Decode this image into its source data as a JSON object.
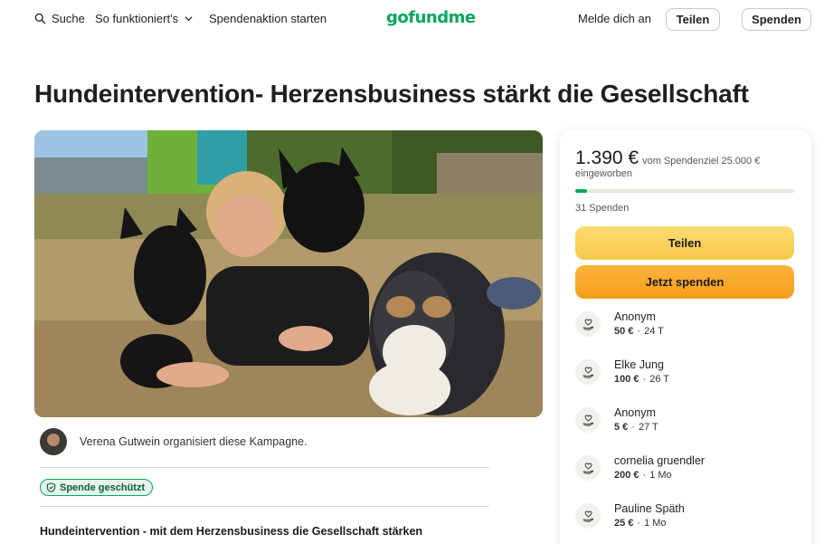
{
  "header": {
    "search_label": "Suche",
    "how_label": "So funktioniert's",
    "start_label": "Spendenaktion starten",
    "logo": "gofundme",
    "login_label": "Melde dich an",
    "share_label": "Teilen",
    "donate_label": "Spenden"
  },
  "campaign": {
    "title": "Hundeintervention- Herzensbusiness stärkt die Gesellschaft",
    "organizer_text": "Verena Gutwein organisiert diese Kampagne.",
    "badge_label": "Spende geschützt",
    "story_title": "Hundeintervention - mit dem Herzensbusiness die Gesellschaft stärken"
  },
  "donation_card": {
    "raised": "1.390 €",
    "goal_text": "vom Spendenziel 25.000 €",
    "raised_sub": "eingeworben",
    "progress_fraction": 0.0556,
    "count_text": "31 Spenden",
    "share_label": "Teilen",
    "donate_label": "Jetzt spenden",
    "donations": [
      {
        "name": "Anonym",
        "amount": "50 €",
        "time": "24 T"
      },
      {
        "name": "Elke Jung",
        "amount": "100 €",
        "time": "26 T"
      },
      {
        "name": "Anonym",
        "amount": "5 €",
        "time": "27 T"
      },
      {
        "name": "cornelia gruendler",
        "amount": "200 €",
        "time": "1 Mo"
      },
      {
        "name": "Pauline Späth",
        "amount": "25 €",
        "time": "1 Mo"
      }
    ]
  },
  "colors": {
    "brand": "#02a95c",
    "share_button": "#f6c84a",
    "donate_button": "#f59d1a"
  },
  "icons": [
    "search-icon",
    "chevron-down-icon",
    "shield-icon",
    "donation-hand-icon"
  ]
}
